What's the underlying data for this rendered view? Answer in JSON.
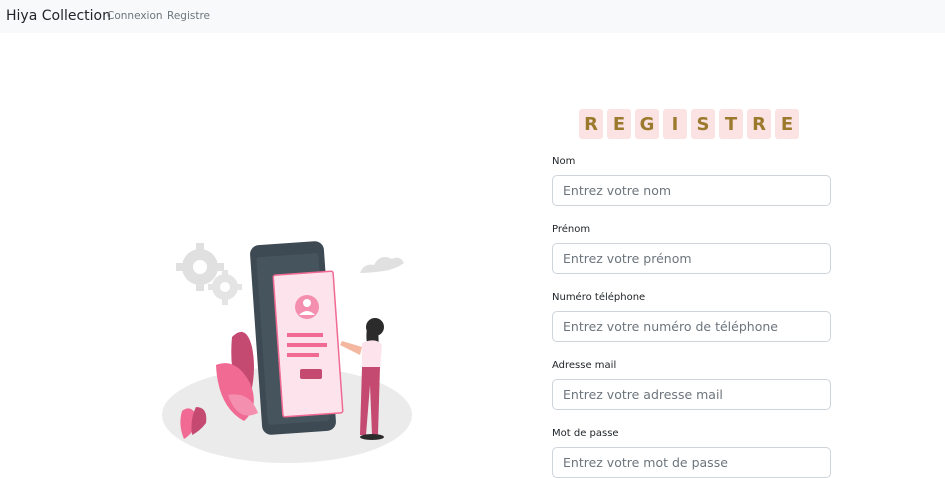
{
  "navbar": {
    "brand": "Hiya Collection",
    "links": [
      "Connexion",
      "Registre"
    ]
  },
  "form": {
    "title_letters": [
      "R",
      "E",
      "G",
      "I",
      "S",
      "T",
      "R",
      "E"
    ],
    "fields": [
      {
        "label": "Nom",
        "placeholder": "Entrez votre nom"
      },
      {
        "label": "Prénom",
        "placeholder": "Entrez votre prénom"
      },
      {
        "label": "Numéro téléphone",
        "placeholder": "Entrez votre numéro de téléphone"
      },
      {
        "label": "Adresse mail",
        "placeholder": "Entrez votre adresse mail"
      },
      {
        "label": "Mot de passe",
        "placeholder": "Entrez votre mot de passe"
      }
    ]
  },
  "colors": {
    "navbar_bg": "#f8f9fa",
    "title_letter_bg": "#fbe3e3",
    "title_letter_text": "#9c7a2d",
    "illustration_pink": "#f06a93",
    "phone_dark": "#3d4a53"
  },
  "illustration": {
    "name": "phone-registration-illustration"
  }
}
